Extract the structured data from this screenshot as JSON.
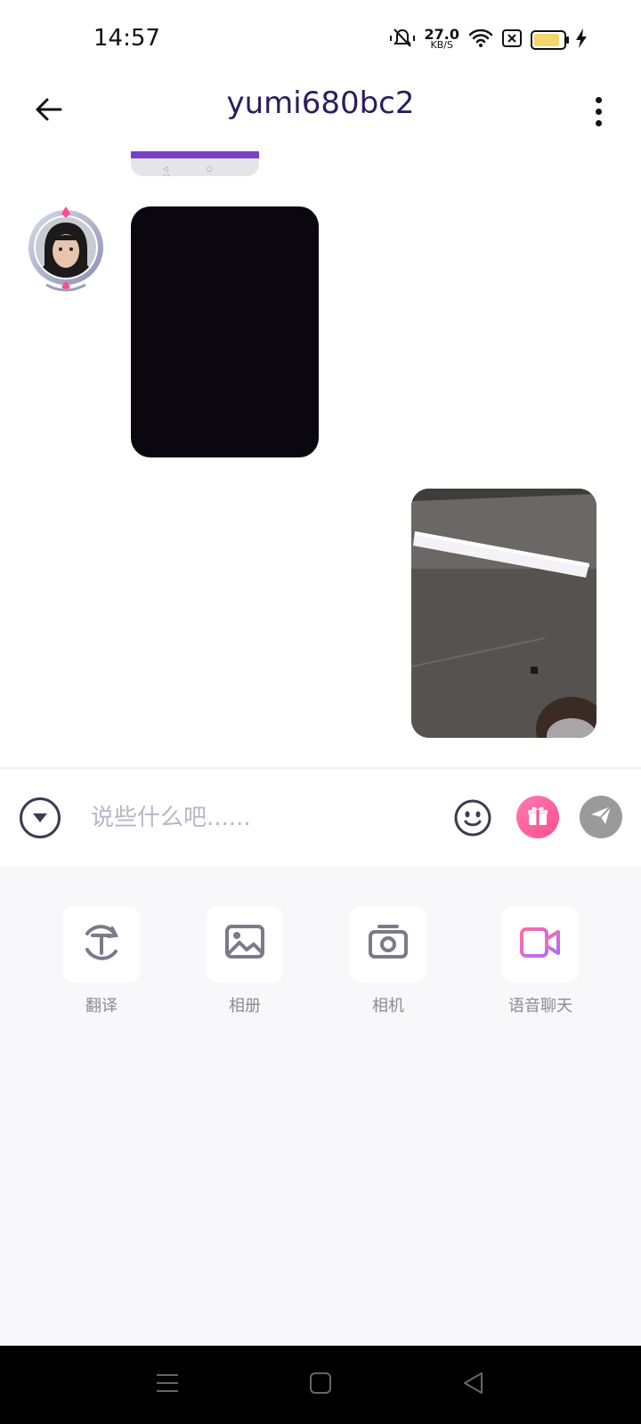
{
  "status_bar": {
    "time": "14:57",
    "net_speed_value": "27.0",
    "net_speed_unit": "KB/S",
    "icons": [
      "mute-vibrate-icon",
      "wifi-icon",
      "sim-off-icon",
      "battery-icon",
      "charging-icon"
    ],
    "battery_level_fraction": 0.78
  },
  "header": {
    "title": "yumi680bc2",
    "back_icon": "arrow-left-icon",
    "more_icon": "more-vertical-icon"
  },
  "chat": {
    "messages": [
      {
        "side": "left",
        "type": "image",
        "partial": true,
        "accent_color": "#7a3fc7"
      },
      {
        "side": "left",
        "type": "image",
        "content": "dark photo",
        "avatar": "user-avatar"
      },
      {
        "side": "right",
        "type": "image",
        "content": "ceiling light photo"
      }
    ]
  },
  "input_bar": {
    "placeholder": "说些什么吧......",
    "collapse_icon": "chevron-down-circle-icon",
    "emoji_icon": "emoji-icon",
    "gift_icon": "gift-icon",
    "send_icon": "send-icon"
  },
  "tools": [
    {
      "label": "翻译",
      "icon": "translate-icon"
    },
    {
      "label": "相册",
      "icon": "gallery-icon"
    },
    {
      "label": "相机",
      "icon": "camera-icon"
    },
    {
      "label": "语音聊天",
      "icon": "video-call-icon"
    }
  ],
  "colors": {
    "title": "#2a1e5c",
    "gift_gradient_start": "#ff7ab2",
    "gift_gradient_end": "#ff4d8f",
    "video_icon_start": "#ff6fa0",
    "video_icon_end": "#b06cff",
    "tools_bg": "#f8f8fa"
  }
}
